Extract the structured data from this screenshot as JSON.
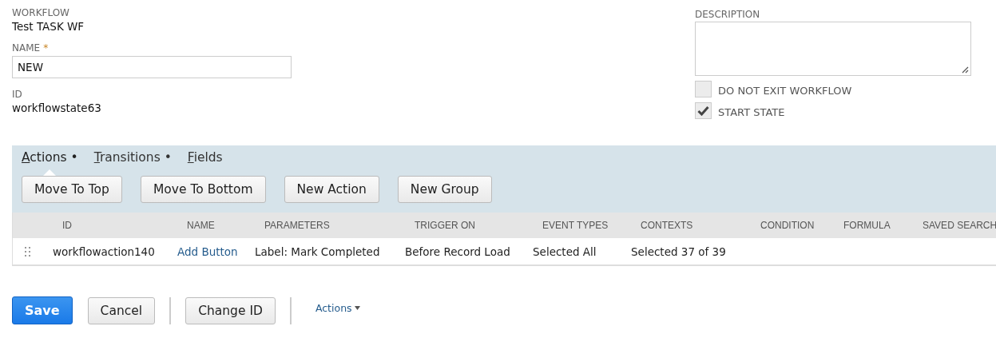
{
  "workflow": {
    "label": "WORKFLOW",
    "value": "Test TASK WF"
  },
  "name": {
    "label": "NAME",
    "required_mark": "*",
    "value": "NEW"
  },
  "id": {
    "label": "ID",
    "value": "workflowstate63"
  },
  "description": {
    "label": "DESCRIPTION"
  },
  "checkboxes": [
    {
      "label": "DO NOT EXIT WORKFLOW",
      "checked": false
    },
    {
      "label": "START STATE",
      "checked": true
    }
  ],
  "tabs": [
    {
      "label": "Actions •",
      "selected": true
    },
    {
      "label": "Transitions •",
      "selected": false
    },
    {
      "label": "Fields",
      "selected": false
    }
  ],
  "toolbar_buttons": [
    "Move To Top",
    "Move To Bottom",
    "New Action",
    "New Group"
  ],
  "table": {
    "columns": [
      "ID",
      "NAME",
      "PARAMETERS",
      "TRIGGER ON",
      "EVENT TYPES",
      "CONTEXTS",
      "CONDITION",
      "FORMULA",
      "SAVED SEARCH"
    ],
    "rows": [
      {
        "cells": [
          "workflowaction140",
          "Add Button",
          "Label: Mark Completed",
          "Before Record Load",
          "Selected All",
          "Selected 37 of 39"
        ]
      }
    ]
  },
  "footer": {
    "save": "Save",
    "cancel": "Cancel",
    "change_id": "Change ID",
    "actions_menu": "Actions"
  }
}
